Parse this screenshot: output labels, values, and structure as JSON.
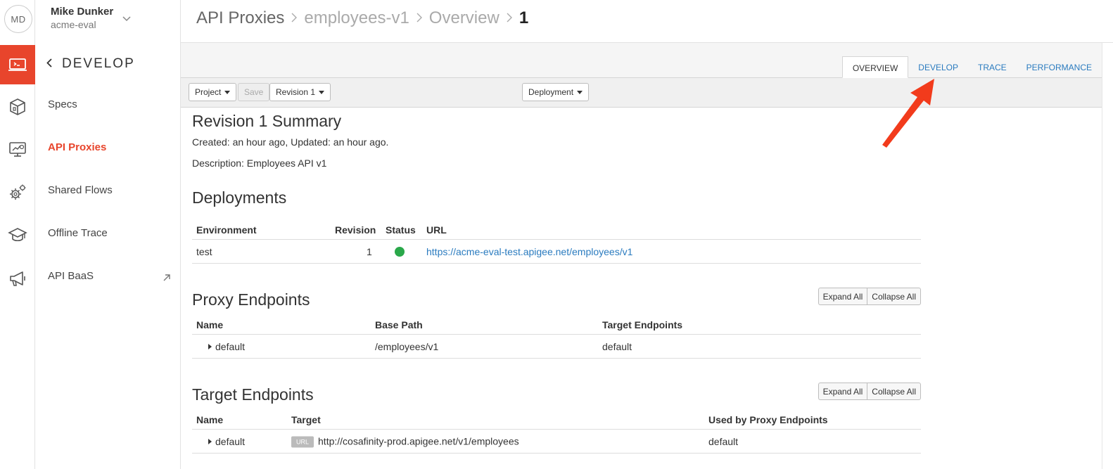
{
  "user": {
    "initials": "MD",
    "name": "Mike Dunker",
    "org": "acme-eval"
  },
  "rail_icons": [
    "develop-icon",
    "publish-icon",
    "analyze-icon",
    "admin-icon",
    "learn-icon",
    "announce-icon"
  ],
  "nav": {
    "back_label": "DEVELOP",
    "items": [
      {
        "label": "Specs",
        "active": false
      },
      {
        "label": "API Proxies",
        "active": true
      },
      {
        "label": "Shared Flows",
        "active": false
      },
      {
        "label": "Offline Trace",
        "active": false
      },
      {
        "label": "API BaaS",
        "active": false,
        "external": true
      }
    ]
  },
  "breadcrumb": {
    "root": "API Proxies",
    "proxy": "employees-v1",
    "section": "Overview",
    "revision": "1"
  },
  "tabs": [
    {
      "label": "OVERVIEW",
      "active": true
    },
    {
      "label": "DEVELOP",
      "active": false
    },
    {
      "label": "TRACE",
      "active": false
    },
    {
      "label": "PERFORMANCE",
      "active": false
    }
  ],
  "toolbar": {
    "project": "Project",
    "save": "Save",
    "revision": "Revision 1",
    "deployment": "Deployment"
  },
  "summary": {
    "title": "Revision 1 Summary",
    "created": "Created: an hour ago, Updated: an hour ago.",
    "description": "Description: Employees API v1"
  },
  "deployments": {
    "title": "Deployments",
    "headers": {
      "environment": "Environment",
      "revision": "Revision",
      "status": "Status",
      "url": "URL"
    },
    "rows": [
      {
        "environment": "test",
        "revision": "1",
        "status": "deployed",
        "url": "https://acme-eval-test.apigee.net/employees/v1"
      }
    ]
  },
  "proxy_endpoints": {
    "title": "Proxy Endpoints",
    "expand_all": "Expand All",
    "collapse_all": "Collapse All",
    "headers": {
      "name": "Name",
      "base_path": "Base Path",
      "target_endpoints": "Target Endpoints"
    },
    "rows": [
      {
        "name": "default",
        "base_path": "/employees/v1",
        "target_endpoints": "default"
      }
    ]
  },
  "target_endpoints": {
    "title": "Target Endpoints",
    "expand_all": "Expand All",
    "collapse_all": "Collapse All",
    "headers": {
      "name": "Name",
      "target": "Target",
      "used_by": "Used by Proxy Endpoints"
    },
    "rows": [
      {
        "name": "default",
        "target_type": "URL",
        "target": "http://cosafinity-prod.apigee.net/v1/employees",
        "used_by": "default"
      }
    ]
  },
  "colors": {
    "accent": "#e8452c",
    "link": "#2a7bbf",
    "status_ok": "#2aa84a"
  }
}
